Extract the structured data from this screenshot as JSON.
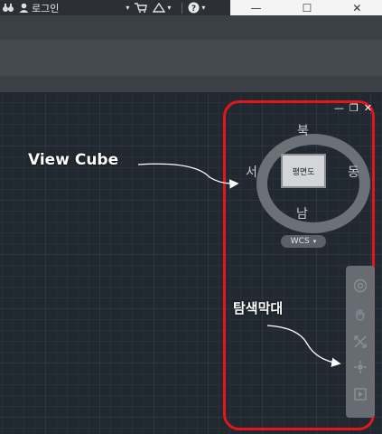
{
  "titlebar": {
    "signin_label": "로그인",
    "window_buttons": [
      "—",
      "☐",
      "✕"
    ]
  },
  "viewcube": {
    "panel_buttons": [
      "—",
      "❐",
      "✕"
    ],
    "face_label": "평면도",
    "north": "북",
    "south": "남",
    "west": "서",
    "east": "동",
    "wcs_label": "WCS"
  },
  "annotations": {
    "viewcube_label": "View  Cube",
    "navbar_label": "탐색막대"
  },
  "colors": {
    "highlight": "#e3161b",
    "canvas": "#212830"
  }
}
